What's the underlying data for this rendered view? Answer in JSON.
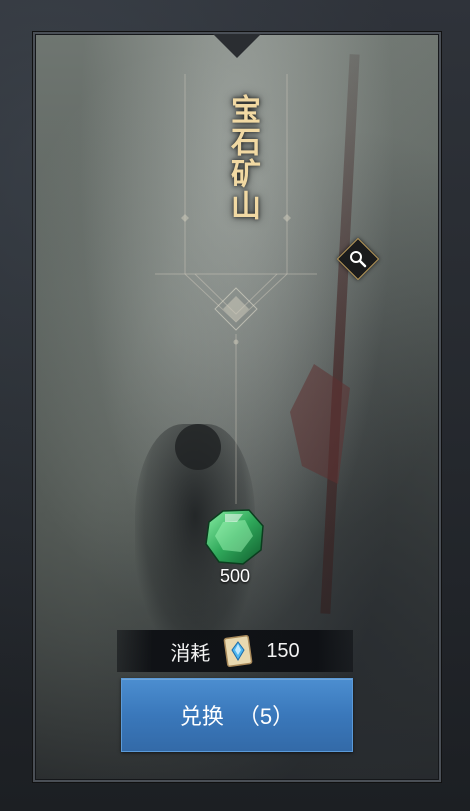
{
  "card": {
    "title": "宝石矿山"
  },
  "reward": {
    "icon": "green-gem-icon",
    "amount": "500"
  },
  "cost": {
    "label": "消耗",
    "icon": "blue-crystal-scroll-icon",
    "value": "150"
  },
  "exchange_button": {
    "label": "兑换",
    "count": "（5）"
  },
  "colors": {
    "title": "#f1d9a3",
    "button": "#3a78bb",
    "gem": "#2fa85a",
    "frame_border": "#4a4f56"
  }
}
